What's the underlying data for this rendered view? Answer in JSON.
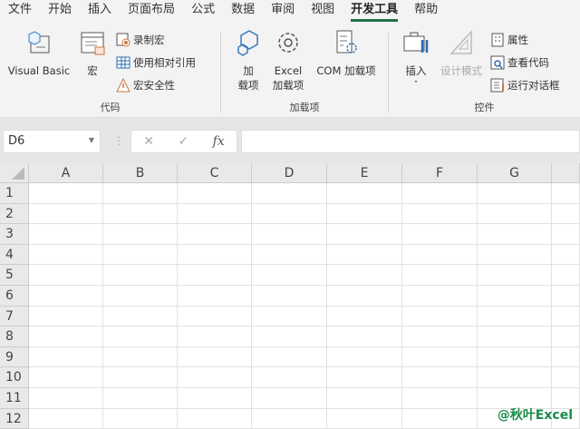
{
  "tabs": [
    "文件",
    "开始",
    "插入",
    "页面布局",
    "公式",
    "数据",
    "审阅",
    "视图",
    "开发工具",
    "帮助"
  ],
  "active_tab": "开发工具",
  "groups": {
    "code": {
      "label": "代码",
      "visual_basic": "Visual Basic",
      "macros": "宏",
      "record_macro": "录制宏",
      "relative_ref": "使用相对引用",
      "macro_security": "宏安全性"
    },
    "addins": {
      "label": "加载项",
      "addins_1": "加",
      "addins_2": "载项",
      "excel_1": "Excel",
      "excel_2": "加载项",
      "com": "COM 加载项"
    },
    "controls": {
      "label": "控件",
      "insert": "插入",
      "design_mode": "设计模式",
      "properties": "属性",
      "view_code": "查看代码",
      "run_dialog": "运行对话框"
    }
  },
  "formula_bar": {
    "name_box": "D6",
    "formula": ""
  },
  "columns": [
    "A",
    "B",
    "C",
    "D",
    "E",
    "F",
    "G"
  ],
  "rows": [
    "1",
    "2",
    "3",
    "4",
    "5",
    "6",
    "7",
    "8",
    "9",
    "10",
    "11",
    "12"
  ],
  "watermark": "@秋叶Excel"
}
